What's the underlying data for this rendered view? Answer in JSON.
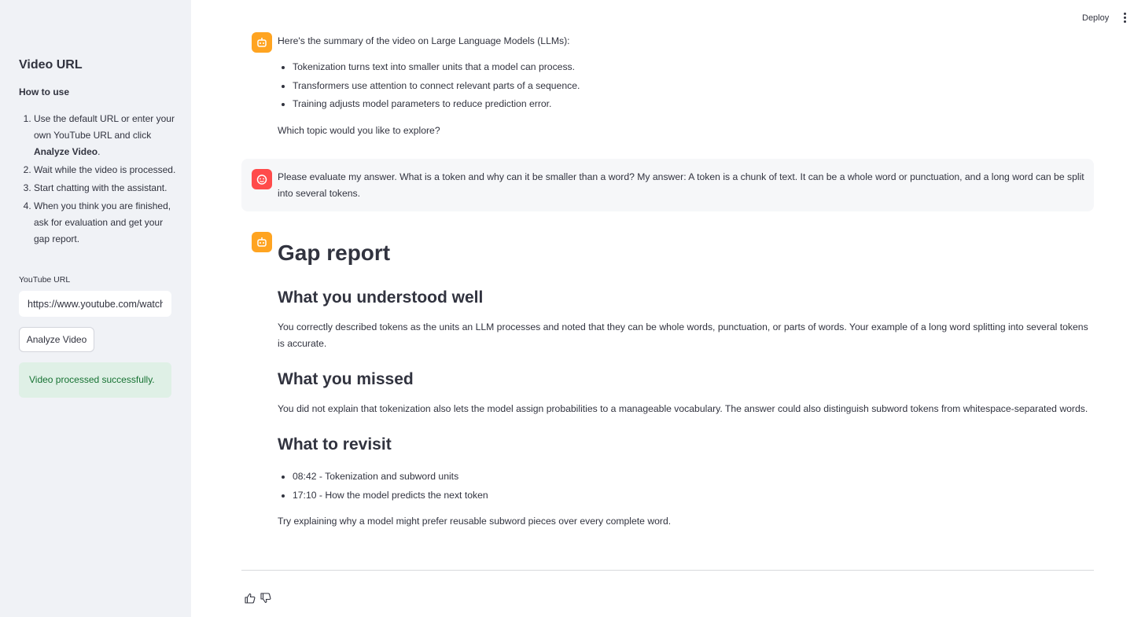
{
  "sidebar": {
    "title": "Video URL",
    "how_to_use": "How to use",
    "steps": {
      "s1_a": "Use the default URL or enter your own YouTube URL and click ",
      "s1_b": "Analyze Video",
      "s1_c": ".",
      "s2": "Wait while the video is processed.",
      "s3": "Start chatting with the assistant.",
      "s4": "When you think you are finished, ask for evaluation and get your gap report."
    },
    "url_label": "YouTube URL",
    "url_value": "https://www.youtube.com/watch",
    "analyze_button": "Analyze Video",
    "success_message": "Video processed successfully."
  },
  "header": {
    "deploy": "Deploy"
  },
  "chat": {
    "assistant_summary": {
      "intro": "Here's the summary of the video on Large Language Models (LLMs):",
      "bullets": [
        "Tokenization turns text into smaller units that a model can process.",
        "Transformers use attention to connect relevant parts of a sequence.",
        "Training adjusts model parameters to reduce prediction error."
      ],
      "question": "Which topic would you like to explore?"
    },
    "user_message": "Please evaluate my answer. What is a token and why can it be smaller than a word? My answer: A token is a chunk of text. It can be a whole word or punctuation, and a long word can be split into several tokens.",
    "gap_report": {
      "title": "Gap report",
      "understood_heading": "What you understood well",
      "understood_text": "You correctly described tokens as the units an LLM processes and noted that they can be whole words, punctuation, or parts of words. Your example of a long word splitting into several tokens is accurate.",
      "missed_heading": "What you missed",
      "missed_text": "You did not explain that tokenization also lets the model assign probabilities to a manageable vocabulary. The answer could also distinguish subword tokens from whitespace-separated words.",
      "revisit_heading": "What to revisit",
      "revisit_items": [
        "08:42 - Tokenization and subword units",
        "17:10 - How the model predicts the next token"
      ],
      "closing": "Try explaining why a model might prefer reusable subword pieces over every complete word."
    }
  },
  "colors": {
    "sidebar_bg": "#f0f2f6",
    "bot_avatar": "#ffa421",
    "user_avatar": "#ff4b4b",
    "success_bg": "#dff0e6",
    "success_text": "#177233"
  },
  "icons": {
    "bot": "robot-face-icon",
    "user": "smiley-face-icon",
    "menu": "kebab-menu-icon",
    "thumbs_up": "thumbs-up-icon",
    "thumbs_down": "thumbs-down-icon"
  }
}
